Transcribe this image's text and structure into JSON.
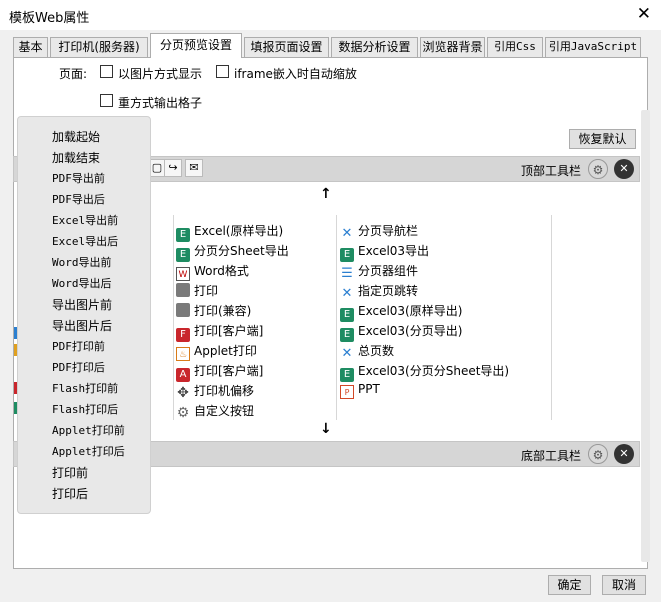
{
  "window": {
    "title": "模板Web属性",
    "close_glyph": "✕"
  },
  "tabs": [
    {
      "label": "基本"
    },
    {
      "label": "打印机(服务器)"
    },
    {
      "label": "分页预览设置",
      "active": true
    },
    {
      "label": "填报页面设置"
    },
    {
      "label": "数据分析设置"
    },
    {
      "label": "浏览器背景"
    },
    {
      "label": "引用Css"
    },
    {
      "label": "引用JavaScript"
    }
  ],
  "options": {
    "page_label": "页面:",
    "image_mode": {
      "label": "以图片方式显示",
      "checked": false
    },
    "iframe_zoom": {
      "label": "iframe嵌入时自动缩放",
      "checked": false
    },
    "repeat_grid": {
      "label": "重方式输出格子",
      "checked": false
    }
  },
  "restore_default_label": "恢复默认",
  "top_toolbar": {
    "label": "顶部工具栏"
  },
  "bottom_toolbar": {
    "label": "底部工具栏"
  },
  "arrows": {
    "up": "↑",
    "down": "↓"
  },
  "toolbar_icons": [
    "icon-partial",
    "export-icon",
    "mail-icon"
  ],
  "buttons_col2": [
    {
      "label": "Excel(原样导出)",
      "icon": "excel-icon"
    },
    {
      "label": "分页分Sheet导出",
      "icon": "excel-icon"
    },
    {
      "label": "Word格式",
      "icon": "word-icon"
    },
    {
      "label": "打印",
      "icon": "printer-icon"
    },
    {
      "label": "打印(兼容)",
      "icon": "printer-icon"
    },
    {
      "label": "打印[客户端]",
      "icon": "pdf-icon"
    },
    {
      "label": "Applet打印",
      "icon": "java-icon"
    },
    {
      "label": "打印[客户端]",
      "icon": "pdf-icon"
    },
    {
      "label": "打印机偏移",
      "icon": "move-icon"
    },
    {
      "label": "自定义按钮",
      "icon": "gear-icon"
    }
  ],
  "buttons_col3": [
    {
      "label": "分页导航栏",
      "icon": "navigation-icon"
    },
    {
      "label": "Excel03导出",
      "icon": "excel-icon"
    },
    {
      "label": "分页器组件",
      "icon": "list-icon"
    },
    {
      "label": "指定页跳转",
      "icon": "navigation-icon"
    },
    {
      "label": "Excel03(原样导出)",
      "icon": "excel-icon"
    },
    {
      "label": "Excel03(分页导出)",
      "icon": "excel-icon"
    },
    {
      "label": "总页数",
      "icon": "navigation-icon"
    },
    {
      "label": "Excel03(分页分Sheet导出)",
      "icon": "excel-icon"
    },
    {
      "label": "PPT",
      "icon": "ppt-icon"
    }
  ],
  "event_menu": [
    "加载起始",
    "加载结束",
    "PDF导出前",
    "PDF导出后",
    "Excel导出前",
    "Excel导出后",
    "Word导出前",
    "Word导出后",
    "导出图片前",
    "导出图片后",
    "PDF打印前",
    "PDF打印后",
    "Flash打印前",
    "Flash打印后",
    "Applet打印前",
    "Applet打印后",
    "打印前",
    "打印后"
  ],
  "footer": {
    "ok_label": "确定",
    "cancel_label": "取消"
  },
  "colors": {
    "excel": "#1e8c62",
    "pdf": "#c9262c",
    "nav": "#2b7fd0"
  }
}
